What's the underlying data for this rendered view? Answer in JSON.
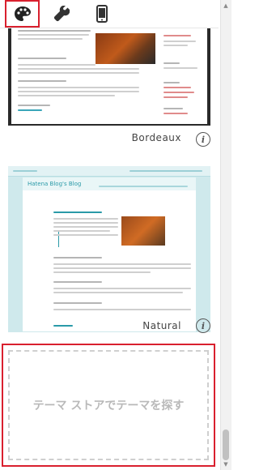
{
  "tabs": [
    {
      "name": "palette-icon",
      "active": true
    },
    {
      "name": "wrench-icon",
      "active": false
    },
    {
      "name": "mobile-icon",
      "active": false
    }
  ],
  "themes": [
    {
      "label": "Bordeaux"
    },
    {
      "label": "Natural",
      "thumbnail_title": "Hatena Blog's Blog"
    }
  ],
  "store": {
    "label": "テーマ ストアでテーマを探す"
  },
  "colors": {
    "accent": "#d9202e",
    "natural_accent": "#2a9aa8"
  }
}
